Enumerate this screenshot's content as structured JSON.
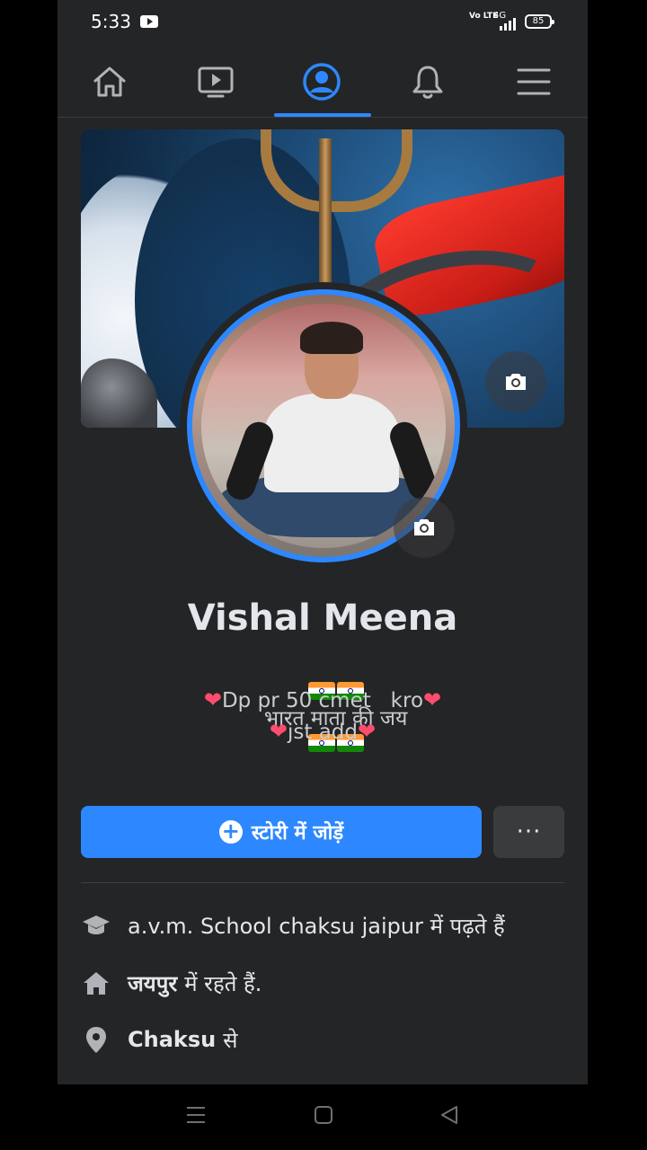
{
  "status_bar": {
    "time": "5:33",
    "network_label": "Vo LTE",
    "signal_label": "4G",
    "battery": "85"
  },
  "nav": {
    "tabs": [
      {
        "id": "home",
        "icon": "home-icon"
      },
      {
        "id": "watch",
        "icon": "video-icon"
      },
      {
        "id": "profile",
        "icon": "profile-icon",
        "active": true
      },
      {
        "id": "notifications",
        "icon": "bell-icon"
      },
      {
        "id": "menu",
        "icon": "menu-icon"
      }
    ],
    "accent_color": "#2d88ff"
  },
  "profile": {
    "name": "Vishal Meena",
    "bio_line1": "भारत माता की जय",
    "bio_line2": "Dp pr 50 cmet   kro",
    "bio_line3": "jst add"
  },
  "actions": {
    "add_story_label": "स्टोरी में जोड़ें",
    "more_label": "···"
  },
  "details": [
    {
      "icon": "education-icon",
      "bold": "",
      "text": "a.v.m. School chaksu jaipur में पढ़ते हैं"
    },
    {
      "icon": "home-icon",
      "bold": "जयपुर",
      "text": "में रहते हैं."
    },
    {
      "icon": "location-pin-icon",
      "bold": "Chaksu",
      "text": "से"
    }
  ]
}
